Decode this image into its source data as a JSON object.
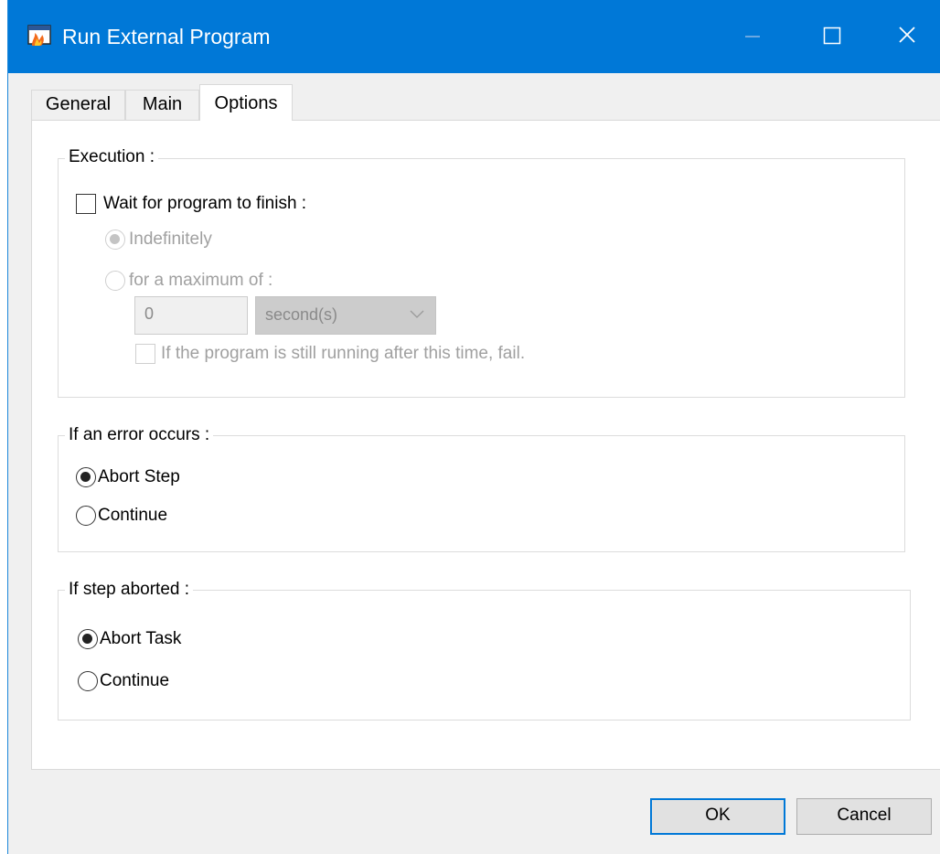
{
  "window": {
    "title": "Run External Program"
  },
  "tabs": [
    {
      "label": "General",
      "active": false
    },
    {
      "label": "Main",
      "active": false
    },
    {
      "label": "Options",
      "active": true
    }
  ],
  "execution": {
    "group_label": "Execution :",
    "wait_checkbox": {
      "label": "Wait for program to finish :",
      "checked": false
    },
    "indefinitely": {
      "label": "Indefinitely",
      "selected": true,
      "enabled": false
    },
    "max_radio": {
      "label": "for a maximum of :",
      "selected": false,
      "enabled": false
    },
    "max_value": "0",
    "unit": "second(s)",
    "fail_checkbox": {
      "label": "If the program is still running after this time, fail.",
      "checked": false,
      "enabled": false
    }
  },
  "error_group": {
    "group_label": "If an error occurs :",
    "options": [
      {
        "label": "Abort Step",
        "selected": true
      },
      {
        "label": "Continue",
        "selected": false
      }
    ]
  },
  "aborted_group": {
    "group_label": "If step aborted :",
    "options": [
      {
        "label": "Abort Task",
        "selected": true
      },
      {
        "label": "Continue",
        "selected": false
      }
    ]
  },
  "buttons": {
    "ok": "OK",
    "cancel": "Cancel"
  },
  "colors": {
    "titlebar": "#0078d7",
    "dialog_bg": "#f0f0f0",
    "panel_bg": "#ffffff",
    "default_button_border": "#0078d7"
  },
  "icons": {
    "app": "app-window-icon",
    "minimize": "minimize-icon",
    "maximize": "maximize-icon",
    "close": "close-icon"
  }
}
